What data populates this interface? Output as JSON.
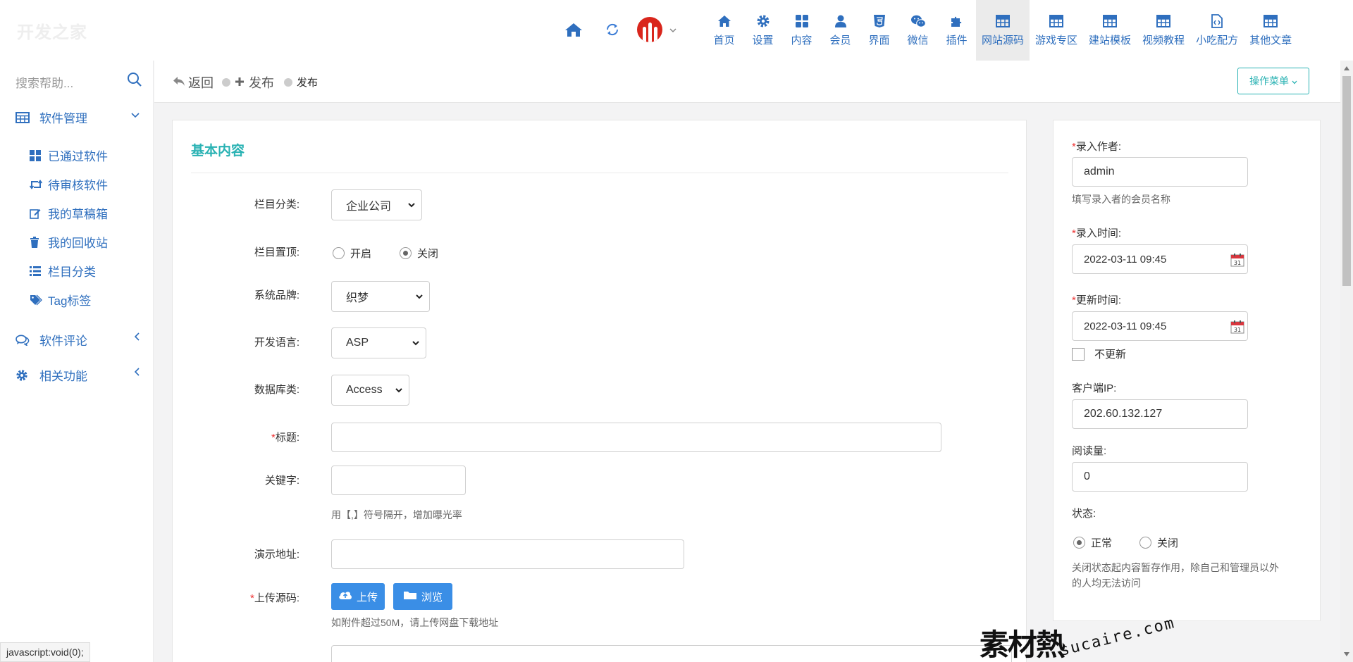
{
  "header": {
    "logo": "开发之家",
    "nav": [
      {
        "label": "首页",
        "icon": "home-icon"
      },
      {
        "label": "设置",
        "icon": "gear-icon"
      },
      {
        "label": "内容",
        "icon": "grid-icon"
      },
      {
        "label": "会员",
        "icon": "user-icon"
      },
      {
        "label": "界面",
        "icon": "html5-icon"
      },
      {
        "label": "微信",
        "icon": "wechat-icon"
      },
      {
        "label": "插件",
        "icon": "puzzle-icon"
      },
      {
        "label": "网站源码",
        "icon": "table-icon"
      },
      {
        "label": "游戏专区",
        "icon": "table-icon"
      },
      {
        "label": "建站模板",
        "icon": "table-icon"
      },
      {
        "label": "视频教程",
        "icon": "table-icon"
      },
      {
        "label": "小吃配方",
        "icon": "code-file-icon"
      },
      {
        "label": "其他文章",
        "icon": "table-icon"
      }
    ],
    "active_nav": "网站源码"
  },
  "sidebar": {
    "search_placeholder": "搜索帮助...",
    "groups": [
      {
        "label": "软件管理",
        "icon": "table-icon",
        "expanded": true
      },
      {
        "label": "软件评论",
        "icon": "comments-icon",
        "expanded": false
      },
      {
        "label": "相关功能",
        "icon": "gear-icon",
        "expanded": false
      }
    ],
    "items": [
      {
        "label": "已通过软件",
        "icon": "grid-icon"
      },
      {
        "label": "待审核软件",
        "icon": "retweet-icon"
      },
      {
        "label": "我的草稿箱",
        "icon": "edit-icon"
      },
      {
        "label": "我的回收站",
        "icon": "trash-icon"
      },
      {
        "label": "栏目分类",
        "icon": "list-icon"
      },
      {
        "label": "Tag标签",
        "icon": "tags-icon"
      }
    ]
  },
  "subbar": {
    "back": "返回",
    "publish_plus": "发布",
    "publish_current": "发布",
    "op_menu": "操作菜单"
  },
  "form": {
    "section_title": "基本内容",
    "category_label": "栏目分类:",
    "category_value": "企业公司",
    "top_label": "栏目置顶:",
    "top_options": [
      "开启",
      "关闭"
    ],
    "brand_label": "系统品牌:",
    "brand_value": "织梦",
    "lang_label": "开发语言:",
    "lang_value": "ASP",
    "db_label": "数据库类:",
    "db_value": "Access",
    "title_label": "标题:",
    "keyword_label": "关键字:",
    "keyword_hint": "用【,】符号隔开，增加曝光率",
    "demo_label": "演示地址:",
    "upload_label": "上传源码:",
    "upload_btn": "上传",
    "browse_btn": "浏览",
    "upload_hint": "如附件超过50M，请上传网盘下载地址"
  },
  "side_form": {
    "author_label": "录入作者:",
    "author_value": "admin",
    "author_hint": "填写录入者的会员名称",
    "created_label": "录入时间:",
    "created_value": "2022-03-11 09:45",
    "updated_label": "更新时间:",
    "updated_value": "2022-03-11 09:45",
    "no_update": "不更新",
    "ip_label": "客户端IP:",
    "ip_value": "202.60.132.127",
    "views_label": "阅读量:",
    "views_value": "0",
    "status_label": "状态:",
    "status_options": [
      "正常",
      "关闭"
    ],
    "status_hint_1": "关闭状态起内容暂存作用，除自己和管理员以外",
    "status_hint_2": "的人均无法访问"
  },
  "statusbar": "javascript:void(0);",
  "watermark": {
    "main": "素材熱",
    "sub": "sucaire.com"
  },
  "colors": {
    "accent": "#29b2b3",
    "link": "#2f6fbe",
    "button": "#3a8ee6",
    "required": "#ee3333"
  }
}
